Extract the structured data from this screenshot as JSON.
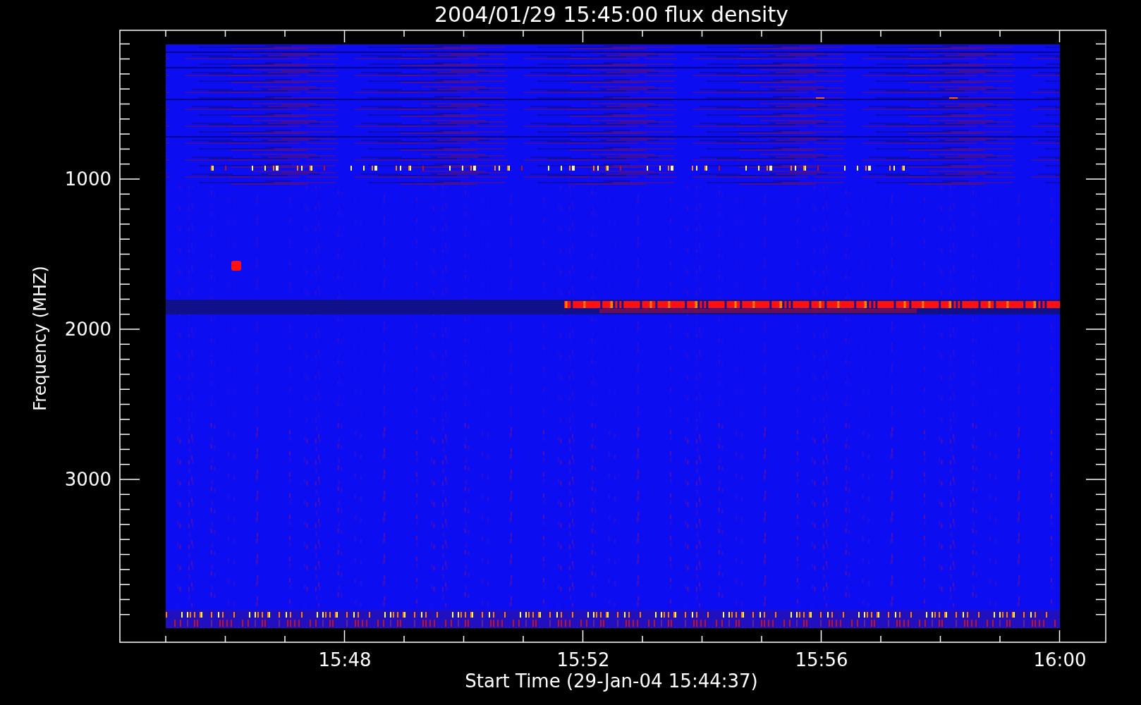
{
  "plot": {
    "title": "2004/01/29 15:45:00 flux density",
    "y_axis": {
      "label": "Frequency (MHZ)",
      "tick_labels": [
        "1000",
        "2000",
        "3000"
      ]
    },
    "x_axis": {
      "label": "Start Time (29-Jan-04 15:44:37)",
      "tick_labels": [
        "15:48",
        "15:52",
        "15:56",
        "16:00"
      ]
    }
  }
}
